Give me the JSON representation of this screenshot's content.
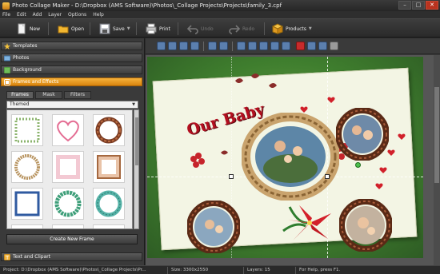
{
  "window": {
    "title": "Photo Collage Maker - D:\\Dropbox (AMS Software)\\Photos\\_Collage Projects\\Projects\\family_3.cpf",
    "minimize": "–",
    "maximize": "□",
    "close": "✕"
  },
  "menu": [
    "File",
    "Edit",
    "Add",
    "Layer",
    "Options",
    "Help"
  ],
  "toolbar": {
    "new": "New",
    "open": "Open",
    "save": "Save",
    "print": "Print",
    "undo": "Undo",
    "redo": "Redo",
    "products": "Products"
  },
  "sidebar": {
    "sections": [
      {
        "label": "Templates",
        "icon": "star-icon"
      },
      {
        "label": "Photos",
        "icon": "photo-icon"
      },
      {
        "label": "Background",
        "icon": "background-icon"
      },
      {
        "label": "Frames and Effects",
        "icon": "frames-icon",
        "active": true
      }
    ],
    "tabs": [
      "Frames",
      "Mask",
      "Filters"
    ],
    "category": "Themed",
    "create_button": "Create New Frame",
    "bottom_section": "Text and Clipart"
  },
  "canvas": {
    "collage_title": "Our Baby"
  },
  "status": {
    "project": "Project: D:\\Dropbox (AMS Software)\\Photos\\_Collage Projects\\Pr...",
    "size": "Size: 3300x2550",
    "layers": "Layers: 15",
    "help": "For Help, press F1."
  },
  "colors": {
    "accent": "#e8991f",
    "title_red": "#b30f1f",
    "grass": "#4f8f38"
  }
}
